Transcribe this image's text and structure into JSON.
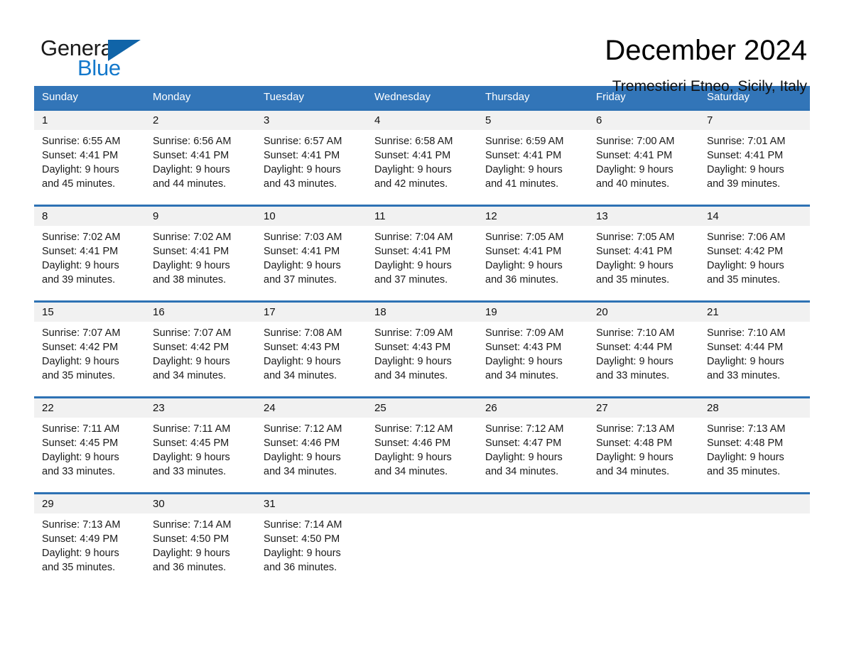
{
  "brand": {
    "name_part1": "General",
    "name_part2": "Blue",
    "triangle_color": "#1064a8",
    "blue_color": "#1378cb"
  },
  "header": {
    "title": "December 2024",
    "subtitle": "Tremestieri Etneo, Sicily, Italy",
    "accent_color": "#3275b8",
    "daynum_band_color": "#f1f1f1",
    "week_rule_color": "#2e72b4"
  },
  "weekday_headers": [
    "Sunday",
    "Monday",
    "Tuesday",
    "Wednesday",
    "Thursday",
    "Friday",
    "Saturday"
  ],
  "weeks": [
    {
      "days": [
        {
          "num": "1",
          "sunrise": "Sunrise: 6:55 AM",
          "sunset": "Sunset: 4:41 PM",
          "daylight_1": "Daylight: 9 hours",
          "daylight_2": "and 45 minutes."
        },
        {
          "num": "2",
          "sunrise": "Sunrise: 6:56 AM",
          "sunset": "Sunset: 4:41 PM",
          "daylight_1": "Daylight: 9 hours",
          "daylight_2": "and 44 minutes."
        },
        {
          "num": "3",
          "sunrise": "Sunrise: 6:57 AM",
          "sunset": "Sunset: 4:41 PM",
          "daylight_1": "Daylight: 9 hours",
          "daylight_2": "and 43 minutes."
        },
        {
          "num": "4",
          "sunrise": "Sunrise: 6:58 AM",
          "sunset": "Sunset: 4:41 PM",
          "daylight_1": "Daylight: 9 hours",
          "daylight_2": "and 42 minutes."
        },
        {
          "num": "5",
          "sunrise": "Sunrise: 6:59 AM",
          "sunset": "Sunset: 4:41 PM",
          "daylight_1": "Daylight: 9 hours",
          "daylight_2": "and 41 minutes."
        },
        {
          "num": "6",
          "sunrise": "Sunrise: 7:00 AM",
          "sunset": "Sunset: 4:41 PM",
          "daylight_1": "Daylight: 9 hours",
          "daylight_2": "and 40 minutes."
        },
        {
          "num": "7",
          "sunrise": "Sunrise: 7:01 AM",
          "sunset": "Sunset: 4:41 PM",
          "daylight_1": "Daylight: 9 hours",
          "daylight_2": "and 39 minutes."
        }
      ]
    },
    {
      "days": [
        {
          "num": "8",
          "sunrise": "Sunrise: 7:02 AM",
          "sunset": "Sunset: 4:41 PM",
          "daylight_1": "Daylight: 9 hours",
          "daylight_2": "and 39 minutes."
        },
        {
          "num": "9",
          "sunrise": "Sunrise: 7:02 AM",
          "sunset": "Sunset: 4:41 PM",
          "daylight_1": "Daylight: 9 hours",
          "daylight_2": "and 38 minutes."
        },
        {
          "num": "10",
          "sunrise": "Sunrise: 7:03 AM",
          "sunset": "Sunset: 4:41 PM",
          "daylight_1": "Daylight: 9 hours",
          "daylight_2": "and 37 minutes."
        },
        {
          "num": "11",
          "sunrise": "Sunrise: 7:04 AM",
          "sunset": "Sunset: 4:41 PM",
          "daylight_1": "Daylight: 9 hours",
          "daylight_2": "and 37 minutes."
        },
        {
          "num": "12",
          "sunrise": "Sunrise: 7:05 AM",
          "sunset": "Sunset: 4:41 PM",
          "daylight_1": "Daylight: 9 hours",
          "daylight_2": "and 36 minutes."
        },
        {
          "num": "13",
          "sunrise": "Sunrise: 7:05 AM",
          "sunset": "Sunset: 4:41 PM",
          "daylight_1": "Daylight: 9 hours",
          "daylight_2": "and 35 minutes."
        },
        {
          "num": "14",
          "sunrise": "Sunrise: 7:06 AM",
          "sunset": "Sunset: 4:42 PM",
          "daylight_1": "Daylight: 9 hours",
          "daylight_2": "and 35 minutes."
        }
      ]
    },
    {
      "days": [
        {
          "num": "15",
          "sunrise": "Sunrise: 7:07 AM",
          "sunset": "Sunset: 4:42 PM",
          "daylight_1": "Daylight: 9 hours",
          "daylight_2": "and 35 minutes."
        },
        {
          "num": "16",
          "sunrise": "Sunrise: 7:07 AM",
          "sunset": "Sunset: 4:42 PM",
          "daylight_1": "Daylight: 9 hours",
          "daylight_2": "and 34 minutes."
        },
        {
          "num": "17",
          "sunrise": "Sunrise: 7:08 AM",
          "sunset": "Sunset: 4:43 PM",
          "daylight_1": "Daylight: 9 hours",
          "daylight_2": "and 34 minutes."
        },
        {
          "num": "18",
          "sunrise": "Sunrise: 7:09 AM",
          "sunset": "Sunset: 4:43 PM",
          "daylight_1": "Daylight: 9 hours",
          "daylight_2": "and 34 minutes."
        },
        {
          "num": "19",
          "sunrise": "Sunrise: 7:09 AM",
          "sunset": "Sunset: 4:43 PM",
          "daylight_1": "Daylight: 9 hours",
          "daylight_2": "and 34 minutes."
        },
        {
          "num": "20",
          "sunrise": "Sunrise: 7:10 AM",
          "sunset": "Sunset: 4:44 PM",
          "daylight_1": "Daylight: 9 hours",
          "daylight_2": "and 33 minutes."
        },
        {
          "num": "21",
          "sunrise": "Sunrise: 7:10 AM",
          "sunset": "Sunset: 4:44 PM",
          "daylight_1": "Daylight: 9 hours",
          "daylight_2": "and 33 minutes."
        }
      ]
    },
    {
      "days": [
        {
          "num": "22",
          "sunrise": "Sunrise: 7:11 AM",
          "sunset": "Sunset: 4:45 PM",
          "daylight_1": "Daylight: 9 hours",
          "daylight_2": "and 33 minutes."
        },
        {
          "num": "23",
          "sunrise": "Sunrise: 7:11 AM",
          "sunset": "Sunset: 4:45 PM",
          "daylight_1": "Daylight: 9 hours",
          "daylight_2": "and 33 minutes."
        },
        {
          "num": "24",
          "sunrise": "Sunrise: 7:12 AM",
          "sunset": "Sunset: 4:46 PM",
          "daylight_1": "Daylight: 9 hours",
          "daylight_2": "and 34 minutes."
        },
        {
          "num": "25",
          "sunrise": "Sunrise: 7:12 AM",
          "sunset": "Sunset: 4:46 PM",
          "daylight_1": "Daylight: 9 hours",
          "daylight_2": "and 34 minutes."
        },
        {
          "num": "26",
          "sunrise": "Sunrise: 7:12 AM",
          "sunset": "Sunset: 4:47 PM",
          "daylight_1": "Daylight: 9 hours",
          "daylight_2": "and 34 minutes."
        },
        {
          "num": "27",
          "sunrise": "Sunrise: 7:13 AM",
          "sunset": "Sunset: 4:48 PM",
          "daylight_1": "Daylight: 9 hours",
          "daylight_2": "and 34 minutes."
        },
        {
          "num": "28",
          "sunrise": "Sunrise: 7:13 AM",
          "sunset": "Sunset: 4:48 PM",
          "daylight_1": "Daylight: 9 hours",
          "daylight_2": "and 35 minutes."
        }
      ]
    },
    {
      "days": [
        {
          "num": "29",
          "sunrise": "Sunrise: 7:13 AM",
          "sunset": "Sunset: 4:49 PM",
          "daylight_1": "Daylight: 9 hours",
          "daylight_2": "and 35 minutes."
        },
        {
          "num": "30",
          "sunrise": "Sunrise: 7:14 AM",
          "sunset": "Sunset: 4:50 PM",
          "daylight_1": "Daylight: 9 hours",
          "daylight_2": "and 36 minutes."
        },
        {
          "num": "31",
          "sunrise": "Sunrise: 7:14 AM",
          "sunset": "Sunset: 4:50 PM",
          "daylight_1": "Daylight: 9 hours",
          "daylight_2": "and 36 minutes."
        },
        {
          "num": "",
          "sunrise": "",
          "sunset": "",
          "daylight_1": "",
          "daylight_2": ""
        },
        {
          "num": "",
          "sunrise": "",
          "sunset": "",
          "daylight_1": "",
          "daylight_2": ""
        },
        {
          "num": "",
          "sunrise": "",
          "sunset": "",
          "daylight_1": "",
          "daylight_2": ""
        },
        {
          "num": "",
          "sunrise": "",
          "sunset": "",
          "daylight_1": "",
          "daylight_2": ""
        }
      ]
    }
  ]
}
